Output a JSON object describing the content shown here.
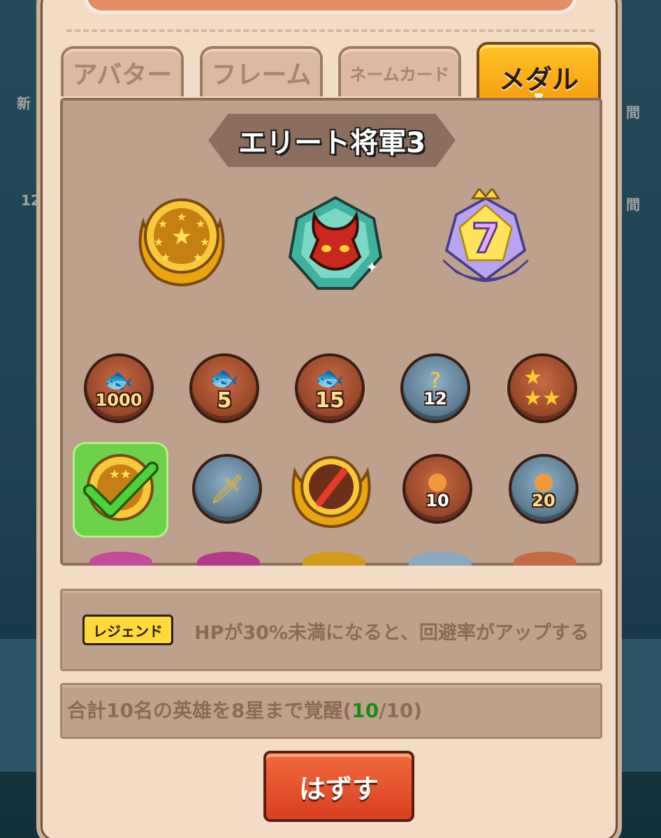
{
  "tabs": [
    {
      "label": "アバター",
      "active": false
    },
    {
      "label": "フレーム",
      "active": false
    },
    {
      "label": "ネームカード",
      "active": false
    },
    {
      "label": "メダル",
      "active": true
    }
  ],
  "selected_medal": {
    "title": "エリート将軍3"
  },
  "medal_grid": {
    "row1": [
      "1000",
      "5",
      "15",
      "12",
      ""
    ],
    "row2": [
      "",
      "",
      "",
      "10",
      "20"
    ]
  },
  "effect": {
    "rarity": "レジェンド",
    "text": "HPが30%未満になると、回避率がアップする"
  },
  "condition": {
    "prefix": "合計10名の英雄を8星まで覚醒(",
    "progress": "10",
    "suffix": "/10)"
  },
  "unequip_button": "はずす",
  "background_labels": {
    "left_1": "新",
    "left_2": "12",
    "right_1": "間",
    "right_2": "間"
  },
  "colors": {
    "active_tab": "#f59a0c",
    "button": "#d94020",
    "rarity_badge": "#ffd93a",
    "progress": "#1e8a12"
  }
}
